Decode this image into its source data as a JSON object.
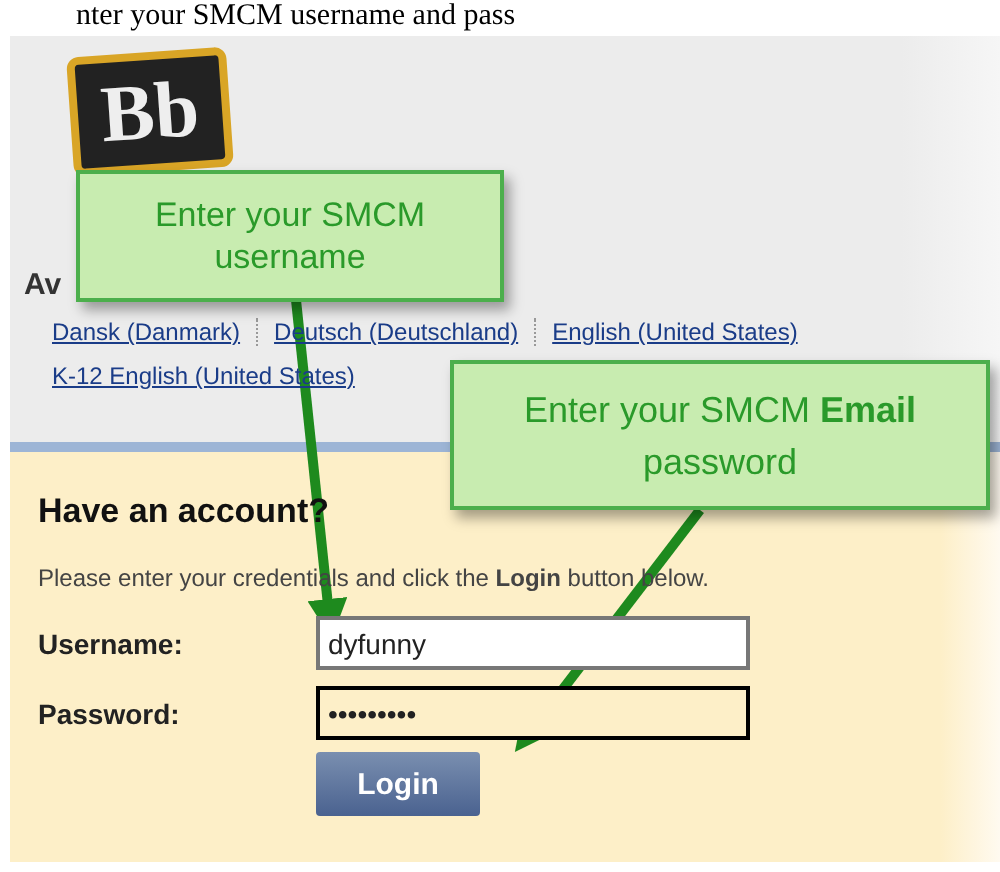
{
  "header": {
    "text": "nter your SMCM username and pass"
  },
  "logo": {
    "text": "Bb"
  },
  "languages": {
    "heading": "Av",
    "links": [
      "Dansk (Danmark)",
      "Deutsch (Deutschland)",
      "English (United States)",
      "K-12 English (United States)"
    ]
  },
  "login": {
    "title": "Have an account?",
    "instructions": "Please enter your credentials and click the **Login** button below.",
    "fields": [
      {
        "label": "Username:",
        "value": "dyfunny",
        "focused": false
      },
      {
        "label": "Password:",
        "value": "•••••••••",
        "focused": true
      }
    ],
    "button": "Login"
  },
  "callouts": [
    {
      "text": "Enter your SMCM username"
    },
    {
      "text": "Enter your SMCM **Email** password"
    }
  ]
}
